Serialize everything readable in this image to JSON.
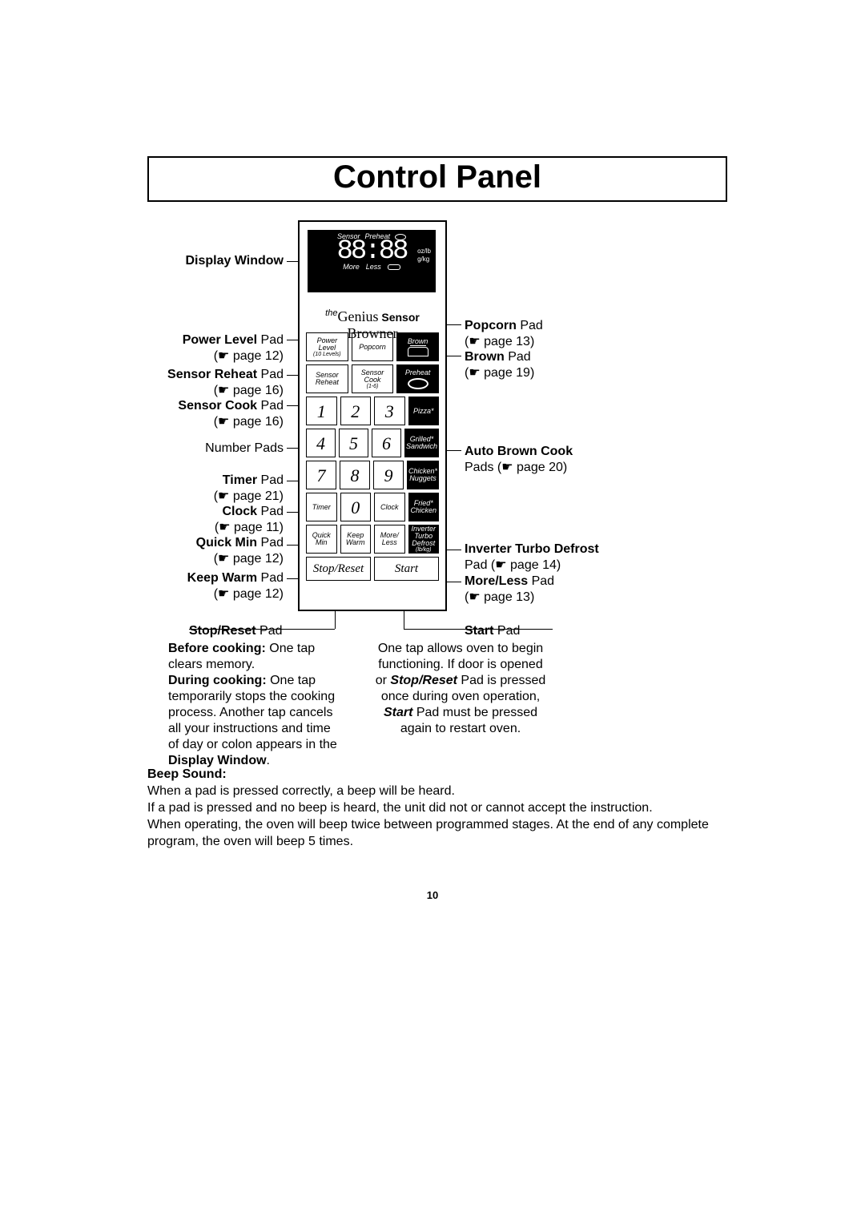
{
  "title": "Control Panel",
  "brand": {
    "the": "the",
    "genius": "Genius",
    "sensor": "Sensor",
    "browner": "Browner"
  },
  "display": {
    "top_left": "Sensor",
    "top_right": "Preheat",
    "digits": "88:88",
    "units_top": "oz/lb",
    "units_bot": "g/kg",
    "bottom_left": "More",
    "bottom_right": "Less"
  },
  "pads": {
    "power_level": "Power Level",
    "power_level_sub": "(10 Levels)",
    "popcorn": "Popcorn",
    "brown": "Brown",
    "sensor_reheat": "Sensor Reheat",
    "sensor_cook": "Sensor Cook",
    "sensor_cook_sub": "(1-6)",
    "preheat": "Preheat",
    "pizza": "Pizza*",
    "grilled": "Grilled* Sandwich",
    "chicken_nuggets": "Chicken* Nuggets",
    "fried_chicken": "Fried* Chicken",
    "timer": "Timer",
    "clock": "Clock",
    "quick_min": "Quick Min",
    "keep_warm": "Keep Warm",
    "more_less": "More/ Less",
    "inverter": "Inverter Turbo Defrost",
    "inverter_sub": "(lb/kg)",
    "stop_reset": "Stop/Reset",
    "start": "Start",
    "n1": "1",
    "n2": "2",
    "n3": "3",
    "n4": "4",
    "n5": "5",
    "n6": "6",
    "n7": "7",
    "n8": "8",
    "n9": "9",
    "n0": "0"
  },
  "labels": {
    "display_window": "Display Window",
    "power_level": {
      "name": "Power Level",
      "suffix": " Pad",
      "ref": "(☛ page 12)"
    },
    "sensor_reheat": {
      "name": "Sensor Reheat",
      "suffix": " Pad",
      "ref": "(☛ page 16)"
    },
    "sensor_cook": {
      "name": "Sensor Cook",
      "suffix": " Pad",
      "ref": "(☛ page 16)"
    },
    "number_pads": "Number Pads",
    "timer": {
      "name": "Timer",
      "suffix": " Pad",
      "ref": "(☛ page 21)"
    },
    "clock": {
      "name": "Clock",
      "suffix": " Pad",
      "ref": "(☛ page 11)"
    },
    "quick_min": {
      "name": "Quick Min",
      "suffix": " Pad",
      "ref": "(☛ page 12)"
    },
    "keep_warm": {
      "name": "Keep Warm",
      "suffix": " Pad",
      "ref": "(☛ page 12)"
    },
    "popcorn": {
      "name": "Popcorn",
      "suffix": " Pad",
      "ref": "(☛ page 13)"
    },
    "brown": {
      "name": "Brown",
      "suffix": " Pad",
      "ref": "(☛ page 19)"
    },
    "auto_brown": {
      "name": "Auto Brown Cook",
      "line2": "Pads (☛ page 20)"
    },
    "inverter": {
      "name": "Inverter Turbo Defrost",
      "line2": "Pad (☛ page 14)"
    },
    "more_less": {
      "name": "More/Less",
      "suffix": " Pad",
      "ref": "(☛ page 13)"
    },
    "stop_reset": {
      "name": "Stop/Reset",
      "suffix": " Pad"
    },
    "start": {
      "name": "Start",
      "suffix": " Pad"
    }
  },
  "footer_left": {
    "before_b": "Before cooking:",
    "before_t": " One tap clears memory.",
    "during_b": "During cooking:",
    "during_t": " One tap temporarily stops the cooking process. Another tap cancels all your instructions and time of day or colon appears in the ",
    "dw_b": "Display Window",
    "dw_t": "."
  },
  "footer_right": {
    "l1": "One tap allows oven to begin",
    "l2": "functioning. If door is opened",
    "l3_a": "or ",
    "l3_b": "Stop/Reset",
    "l3_c": " Pad is pressed",
    "l4": "once during oven operation,",
    "l5_b": "Start",
    "l5_t": " Pad must be pressed",
    "l6": "again to restart oven."
  },
  "beep": {
    "heading": "Beep Sound:",
    "l1": "When a pad is pressed correctly, a beep will be heard.",
    "l2": "If a pad is pressed and no beep is heard, the unit did not or cannot accept the instruction.",
    "l3": "When operating, the oven will beep twice between programmed stages. At the end of any complete program, the oven will beep 5 times."
  },
  "page_number": "10"
}
